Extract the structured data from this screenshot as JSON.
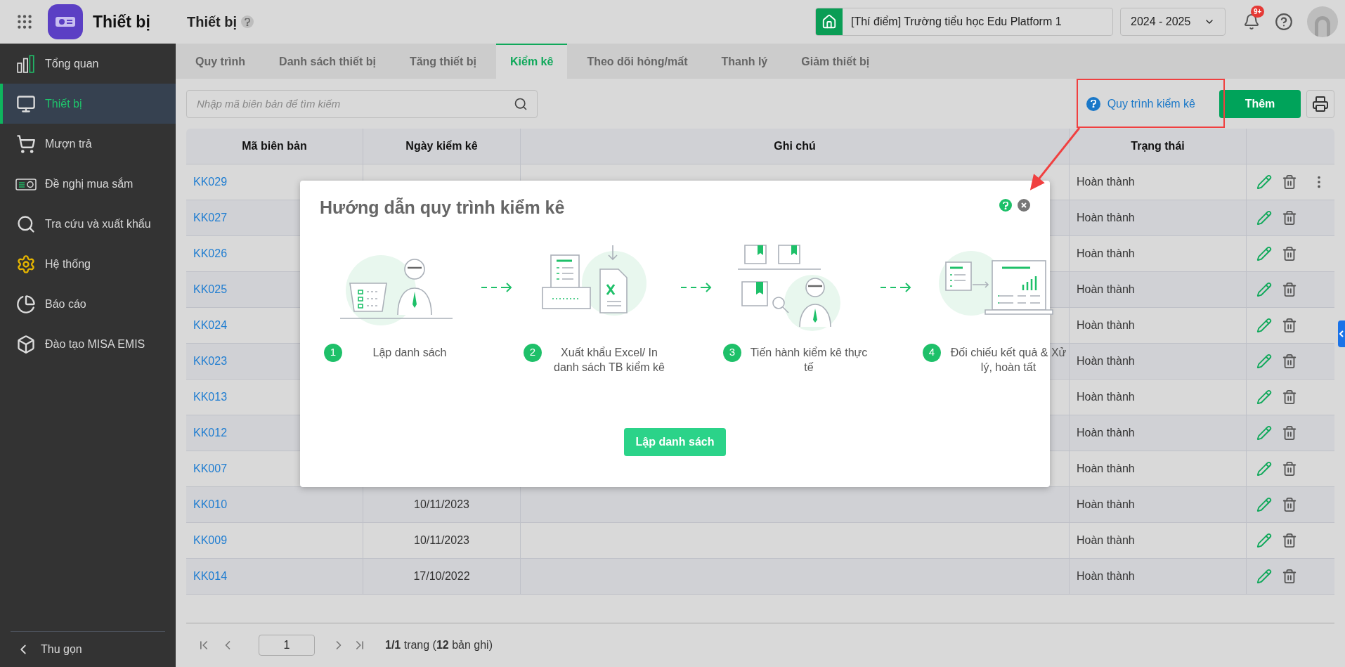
{
  "app": {
    "title": "Thiết bị",
    "page_title": "Thiết bị",
    "school": "[Thí điểm] Trường tiểu học Edu Platform 1",
    "school_year": "2024 - 2025",
    "notification_badge": "9+"
  },
  "sidebar": {
    "items": [
      {
        "label": "Tổng quan",
        "selected": false
      },
      {
        "label": "Thiết bị",
        "selected": true
      },
      {
        "label": "Mượn trả",
        "selected": false
      },
      {
        "label": "Đề nghị mua sắm",
        "selected": false
      },
      {
        "label": "Tra cứu và xuất khẩu",
        "selected": false
      },
      {
        "label": "Hệ thống",
        "selected": false
      },
      {
        "label": "Báo cáo",
        "selected": false
      },
      {
        "label": "Đào tạo MISA EMIS",
        "selected": false
      }
    ],
    "collapse": "Thu gọn"
  },
  "tabs": [
    {
      "label": "Quy trình",
      "selected": false
    },
    {
      "label": "Danh sách thiết bị",
      "selected": false
    },
    {
      "label": "Tăng thiết bị",
      "selected": false
    },
    {
      "label": "Kiểm kê",
      "selected": true
    },
    {
      "label": "Theo dõi hỏng/mất",
      "selected": false
    },
    {
      "label": "Thanh lý",
      "selected": false
    },
    {
      "label": "Giảm thiết bị",
      "selected": false
    }
  ],
  "toolbar": {
    "search_placeholder": "Nhập mã biên bản để tìm kiếm",
    "help_link": "Quy trình kiểm kê",
    "add_button": "Thêm"
  },
  "table": {
    "columns": [
      "Mã biên bản",
      "Ngày kiểm kê",
      "Ghi chú",
      "Trạng thái"
    ],
    "rows": [
      {
        "code": "KK029",
        "status": "Hoàn thành",
        "more_menu": true
      },
      {
        "code": "KK027",
        "status": "Hoàn thành",
        "more_menu": false
      },
      {
        "code": "KK026",
        "status": "Hoàn thành",
        "more_menu": false
      },
      {
        "code": "KK025",
        "status": "Hoàn thành",
        "more_menu": false
      },
      {
        "code": "KK024",
        "status": "Hoàn thành",
        "more_menu": false
      },
      {
        "code": "KK023",
        "status": "Hoàn thành",
        "more_menu": false
      },
      {
        "code": "KK013",
        "status": "Hoàn thành",
        "more_menu": false
      },
      {
        "code": "KK012",
        "status": "Hoàn thành",
        "more_menu": false
      },
      {
        "code": "KK007",
        "status": "Hoàn thành",
        "more_menu": false
      },
      {
        "code": "KK010",
        "date": "10/11/2023",
        "status": "Hoàn thành",
        "more_menu": false
      },
      {
        "code": "KK009",
        "date": "10/11/2023",
        "status": "Hoàn thành",
        "more_menu": false
      },
      {
        "code": "KK014",
        "date": "17/10/2022",
        "status": "Hoàn thành",
        "more_menu": false
      }
    ]
  },
  "pagination": {
    "page": "1",
    "summary": "**1/1** trang (**12** bản ghi)"
  },
  "modal": {
    "title": "Hướng dẫn quy trình kiểm kê",
    "steps": [
      {
        "number": "1",
        "text": "Lập danh sách"
      },
      {
        "number": "2",
        "text": "Xuất khẩu Excel/ In danh sách TB kiểm kê"
      },
      {
        "number": "3",
        "text": "Tiến hành kiểm kê thực tế"
      },
      {
        "number": "4",
        "text": "Đối chiếu kết quả & Xử lý, hoàn tất"
      }
    ],
    "button": "Lập danh sách"
  }
}
